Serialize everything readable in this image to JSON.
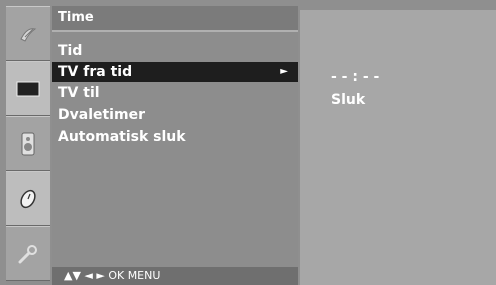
{
  "menu": {
    "title": "Time",
    "items": [
      {
        "label": "Tid"
      },
      {
        "label": "TV fra tid",
        "arrow": "►"
      },
      {
        "label": "TV til"
      },
      {
        "label": "Dvaletimer"
      },
      {
        "label": "Automatisk sluk"
      }
    ],
    "selected_index": 1,
    "nav_hint": "▲▼  ◄ ►  OK  MENU"
  },
  "submenu": {
    "time_value": "- -  :  - -",
    "state_value": "Sluk"
  },
  "icons": [
    "satellite-dish-icon",
    "tv-screen-icon",
    "speaker-icon",
    "clock-icon",
    "wrench-icon"
  ],
  "colors": {
    "background": "#8f8f8f",
    "selected_row": "#1e1e1e",
    "text": "#ffffff"
  }
}
